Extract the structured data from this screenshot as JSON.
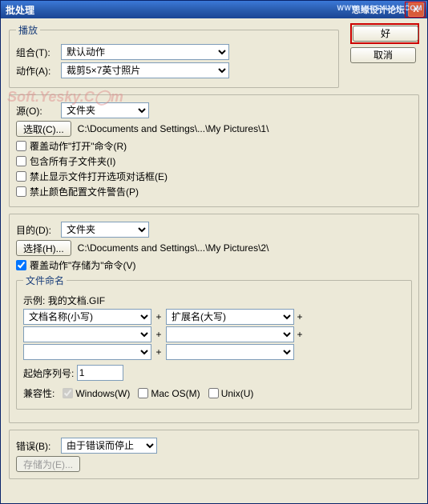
{
  "titlebar": {
    "title": "批处理",
    "right_text": "思缘设计论坛",
    "url_text": "WWW.MISSYUAN.COM",
    "close": "X"
  },
  "buttons": {
    "ok": "好",
    "cancel": "取消"
  },
  "watermark": "Soft.Yesky.C◯m",
  "play": {
    "legend": "播放",
    "set_label": "组合(T):",
    "set_value": "默认动作",
    "action_label": "动作(A):",
    "action_value": "裁剪5×7英寸照片"
  },
  "source": {
    "label": "源(O):",
    "value": "文件夹",
    "choose_btn": "选取(C)...",
    "path": "C:\\Documents and Settings\\...\\My Pictures\\1\\",
    "chk1": "覆盖动作\"打开\"命令(R)",
    "chk2": "包含所有子文件夹(I)",
    "chk3": "禁止显示文件打开选项对话框(E)",
    "chk4": "禁止颜色配置文件警告(P)"
  },
  "dest": {
    "label": "目的(D):",
    "value": "文件夹",
    "choose_btn": "选择(H)...",
    "path": "C:\\Documents and Settings\\...\\My Pictures\\2\\",
    "override": "覆盖动作\"存储为\"命令(V)",
    "naming": {
      "legend": "文件命名",
      "example_label": "示例:",
      "example_value": "我的文档.GIF",
      "f1": "文档名称(小写)",
      "f2": "扩展名(大写)",
      "f3": "",
      "f4": "",
      "f5": "",
      "f6": "",
      "start_label": "起始序列号:",
      "start_value": "1",
      "compat_label": "兼容性:",
      "win": "Windows(W)",
      "mac": "Mac OS(M)",
      "unix": "Unix(U)"
    }
  },
  "errors": {
    "label": "错误(B):",
    "value": "由于错误而停止",
    "save_btn": "存储为(E)..."
  }
}
